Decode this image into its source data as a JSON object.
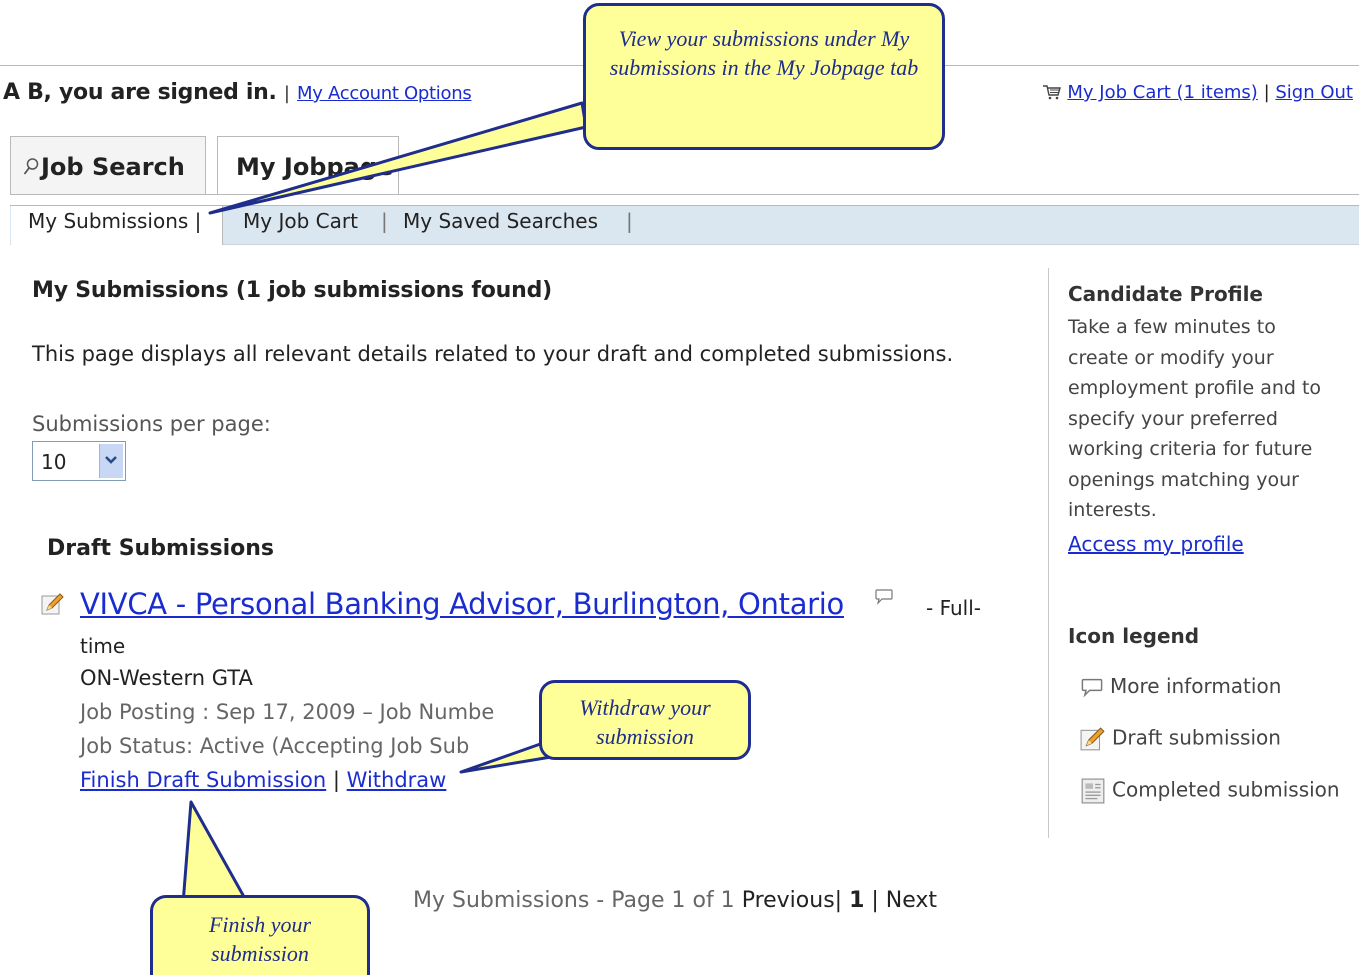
{
  "header": {
    "signed_in": "A B, you are signed in.",
    "sep": "|",
    "account_options": "My Account Options",
    "cart_link": "My Job Cart (1 items)",
    "sign_out": "Sign Out"
  },
  "tabs": [
    {
      "label": "Job Search",
      "icon": "search-icon"
    },
    {
      "label": "My Jobpage"
    }
  ],
  "subnav": {
    "submissions": "My Submissions |",
    "job_cart": "My Job Cart",
    "saved_searches": "My Saved Searches",
    "sep": "|"
  },
  "main": {
    "title": "My Submissions (1 job submissions found)",
    "description": "This page displays all relevant details related to your draft and completed submissions.",
    "per_page_label": "Submissions per page:",
    "per_page_value": "10",
    "draft_title": "Draft Submissions",
    "job": {
      "title": "VIVCA - Personal Banking Advisor, Burlington, Ontario",
      "type_a": "-  Full-",
      "type_b": "time",
      "location": "ON-Western GTA",
      "posting": "Job Posting : Sep 17, 2009 – Job Numbe",
      "status": "Job Status: Active (Accepting Job Sub",
      "finish_link": "Finish Draft Submission",
      "sep": "|",
      "withdraw_link": "Withdraw"
    },
    "pagination": {
      "text": "My Submissions - Page 1 of 1",
      "previous": "Previous|",
      "current": "1",
      "next": "| Next"
    }
  },
  "sidebar": {
    "profile_title": "Candidate Profile",
    "profile_text": "Take a few minutes to create or modify your employment profile and to specify your preferred working criteria for future openings matching your interests.",
    "profile_link": "Access my profile",
    "legend_title": "Icon legend",
    "legend": [
      {
        "label": "More information",
        "icon": "speech-bubble-icon"
      },
      {
        "label": "Draft submission",
        "icon": "pencil-icon"
      },
      {
        "label": "Completed submission",
        "icon": "document-icon"
      }
    ]
  },
  "callouts": {
    "view": "View your submissions under My submissions in the My Jobpage tab",
    "withdraw": "Withdraw your submission",
    "finish": "Finish  your submission"
  },
  "colors": {
    "link": "#1a2ccf",
    "callout_fill": "#ffff99",
    "callout_border": "#1f2d8c",
    "subnav_bg": "#dbe7f0"
  }
}
